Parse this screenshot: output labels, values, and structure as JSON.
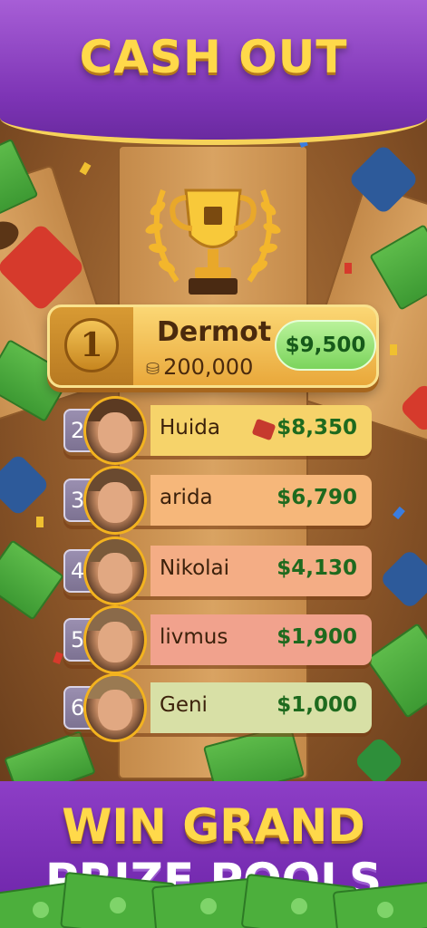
{
  "header": {
    "title": "CASH OUT"
  },
  "leaderboard": {
    "first": {
      "rank": "1",
      "name": "Dermot",
      "score": "200,000",
      "prize": "$9,500"
    },
    "rows": [
      {
        "rank": "2",
        "name": "Huida",
        "prize": "$8,350",
        "color": "#f6d36a"
      },
      {
        "rank": "3",
        "name": "arida",
        "prize": "$6,790",
        "color": "#f6b77a"
      },
      {
        "rank": "4",
        "name": "Nikolai",
        "prize": "$4,130",
        "color": "#f4ad85"
      },
      {
        "rank": "5",
        "name": "livmus",
        "prize": "$1,900",
        "color": "#f1a28d"
      },
      {
        "rank": "6",
        "name": "Geni",
        "prize": "$1,000",
        "color": "#d8e0a6"
      }
    ]
  },
  "footer": {
    "line1": "WIN GRAND",
    "line2": "PRIZE POOLS"
  }
}
